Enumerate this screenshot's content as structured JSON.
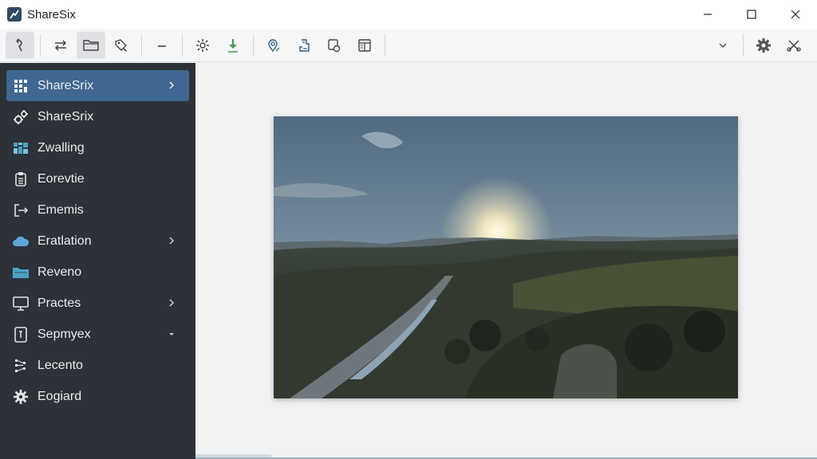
{
  "app": {
    "title": "ShareSix",
    "icon": "app-logo-icon"
  },
  "window_controls": [
    "minimize-icon",
    "maximize-icon",
    "close-icon"
  ],
  "toolbar": {
    "tools": [
      "pointer-tool-icon",
      "swap-arrows-icon",
      "folder-icon",
      "tag-edit-icon",
      "minus-icon",
      "settings-gear-outline-icon",
      "download-arrow-icon",
      "location-pin-icon",
      "document-align-icon",
      "card-shield-icon",
      "layout-panel-icon"
    ],
    "right_tools": [
      "chevron-down-icon",
      "gear-icon",
      "scissors-icon"
    ],
    "accent_download": "#4f9a5a"
  },
  "sidebar": {
    "items": [
      {
        "label": "ShareSrix",
        "icon": "grid-icon",
        "selected": true,
        "chevron": "right"
      },
      {
        "label": "ShareSrix",
        "icon": "gears-icon",
        "selected": false,
        "chevron": ""
      },
      {
        "label": "Zwalling",
        "icon": "dashboard-tiles-icon",
        "selected": false,
        "chevron": ""
      },
      {
        "label": "Eorevtie",
        "icon": "clipboard-icon",
        "selected": false,
        "chevron": ""
      },
      {
        "label": "Ememis",
        "icon": "arrow-bracket-icon",
        "selected": false,
        "chevron": ""
      },
      {
        "label": "Eratlation",
        "icon": "cloud-icon",
        "selected": false,
        "chevron": "right"
      },
      {
        "label": "Reveno",
        "icon": "folder-icon",
        "selected": false,
        "chevron": ""
      },
      {
        "label": "Practes",
        "icon": "monitor-icon",
        "selected": false,
        "chevron": "right"
      },
      {
        "label": "Sepmyex",
        "icon": "document-icon",
        "selected": false,
        "chevron": "down"
      },
      {
        "label": "Lecento",
        "icon": "network-nodes-icon",
        "selected": false,
        "chevron": ""
      },
      {
        "label": "Eogiard",
        "icon": "gear-icon",
        "selected": false,
        "chevron": ""
      }
    ],
    "selected_color": "#3f6791",
    "background": "#2c3237"
  },
  "main": {
    "image_subject": "landscape-sunset-photo"
  }
}
